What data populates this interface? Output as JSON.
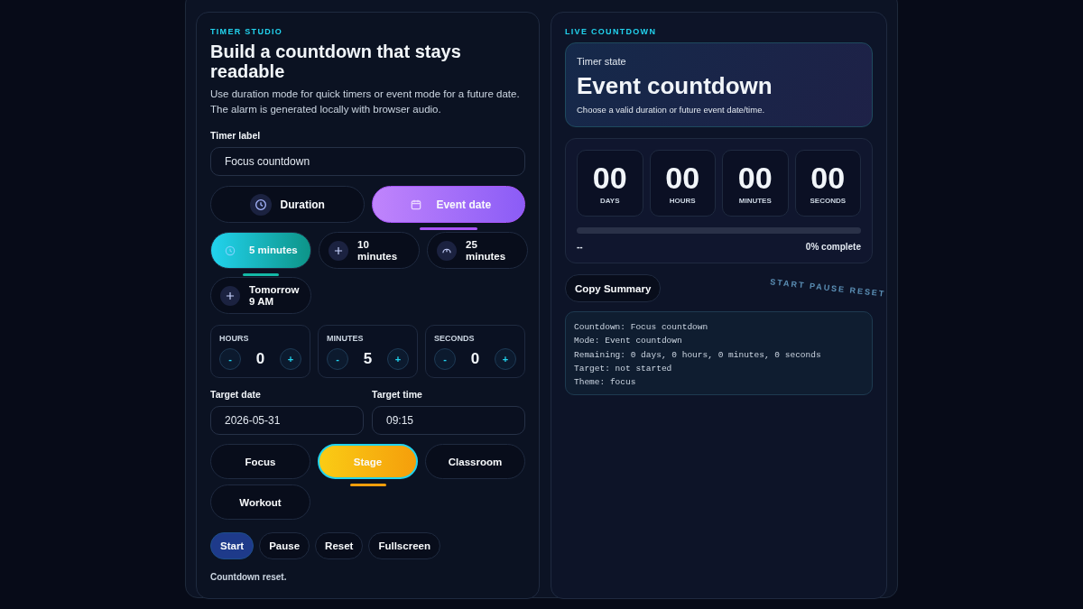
{
  "editor": {
    "eyebrow": "TIMER STUDIO",
    "title": "Build a countdown that stays readable",
    "description": "Use duration mode for quick timers or event mode for a future date. The alarm is generated locally with browser audio.",
    "label_field": {
      "label": "Timer label",
      "value": "Focus countdown"
    },
    "modes": [
      {
        "label": "Duration",
        "kind": "clock",
        "selected": false
      },
      {
        "label": "Event date",
        "kind": "calendar",
        "selected": true
      }
    ],
    "presets": [
      {
        "label": "5 minutes",
        "kind": "clock",
        "selected": true
      },
      {
        "label": "10 minutes",
        "kind": "plus",
        "selected": false
      },
      {
        "label": "25 minutes",
        "kind": "gauge",
        "selected": false
      },
      {
        "label": "Tomorrow 9 AM",
        "kind": "plus",
        "selected": false
      }
    ],
    "steppers": [
      {
        "label": "HOURS",
        "minus": "-",
        "value": "0",
        "plus": "+"
      },
      {
        "label": "MINUTES",
        "minus": "-",
        "value": "5",
        "plus": "+"
      },
      {
        "label": "SECONDS",
        "minus": "-",
        "value": "0",
        "plus": "+"
      }
    ],
    "date_field": {
      "label": "Target date",
      "value": "2026-05-31"
    },
    "time_field": {
      "label": "Target time",
      "value": "09:15"
    },
    "themes": [
      {
        "label": "Focus",
        "selected": false
      },
      {
        "label": "Stage",
        "selected": true
      },
      {
        "label": "Classroom",
        "selected": false
      },
      {
        "label": "Workout",
        "selected": false
      }
    ],
    "actions": [
      {
        "label": "Start",
        "selected": true
      },
      {
        "label": "Pause",
        "selected": false
      },
      {
        "label": "Reset",
        "selected": false
      },
      {
        "label": "Fullscreen",
        "selected": false
      }
    ],
    "status": "Countdown reset."
  },
  "live": {
    "eyebrow": "LIVE COUNTDOWN",
    "state": {
      "caption": "Timer state",
      "title": "Event countdown",
      "note": "Choose a valid duration or future event date/time."
    },
    "units": [
      {
        "value": "00",
        "label": "DAYS"
      },
      {
        "value": "00",
        "label": "HOURS"
      },
      {
        "value": "00",
        "label": "MINUTES"
      },
      {
        "value": "00",
        "label": "SECONDS"
      }
    ],
    "progress": {
      "target": "--",
      "reading": "0% complete"
    },
    "copy_button": "Copy Summary",
    "watermark_text": "START PAUSE RESET",
    "summary": [
      "Countdown: Focus countdown",
      "Mode: Event countdown",
      "Remaining: 0 days, 0 hours, 0 minutes, 0 seconds",
      "Target: not started",
      "Theme: focus"
    ]
  }
}
